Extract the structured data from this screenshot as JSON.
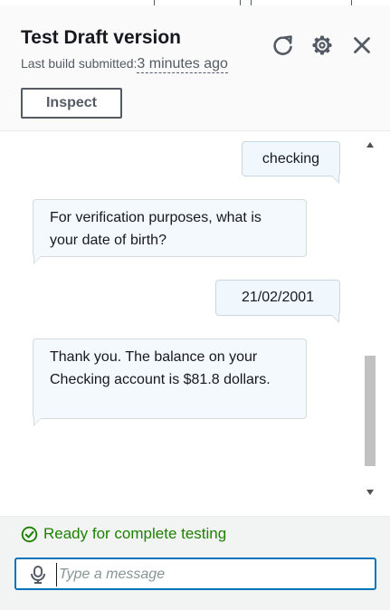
{
  "header": {
    "title": "Test Draft version",
    "subtitle_label": "Last build submitted:",
    "build_time": "3 minutes ago",
    "inspect_label": "Inspect",
    "icons": [
      "refresh-icon",
      "settings-icon",
      "close-icon"
    ]
  },
  "messages": [
    {
      "from": "user",
      "text": "checking"
    },
    {
      "from": "bot",
      "text": "For verification purposes, what is your date of birth?"
    },
    {
      "from": "user",
      "text": "21/02/2001"
    },
    {
      "from": "bot",
      "text": "Thank you. The balance on your Checking account is $81.8 dollars."
    }
  ],
  "footer": {
    "status_text": "Ready for complete testing",
    "input_placeholder": "Type a message",
    "input_value": ""
  },
  "colors": {
    "accent": "#0073bb",
    "success": "#1d8102",
    "user_bubble": "#f0f8fd",
    "bot_bubble": "#f4f9fd"
  }
}
